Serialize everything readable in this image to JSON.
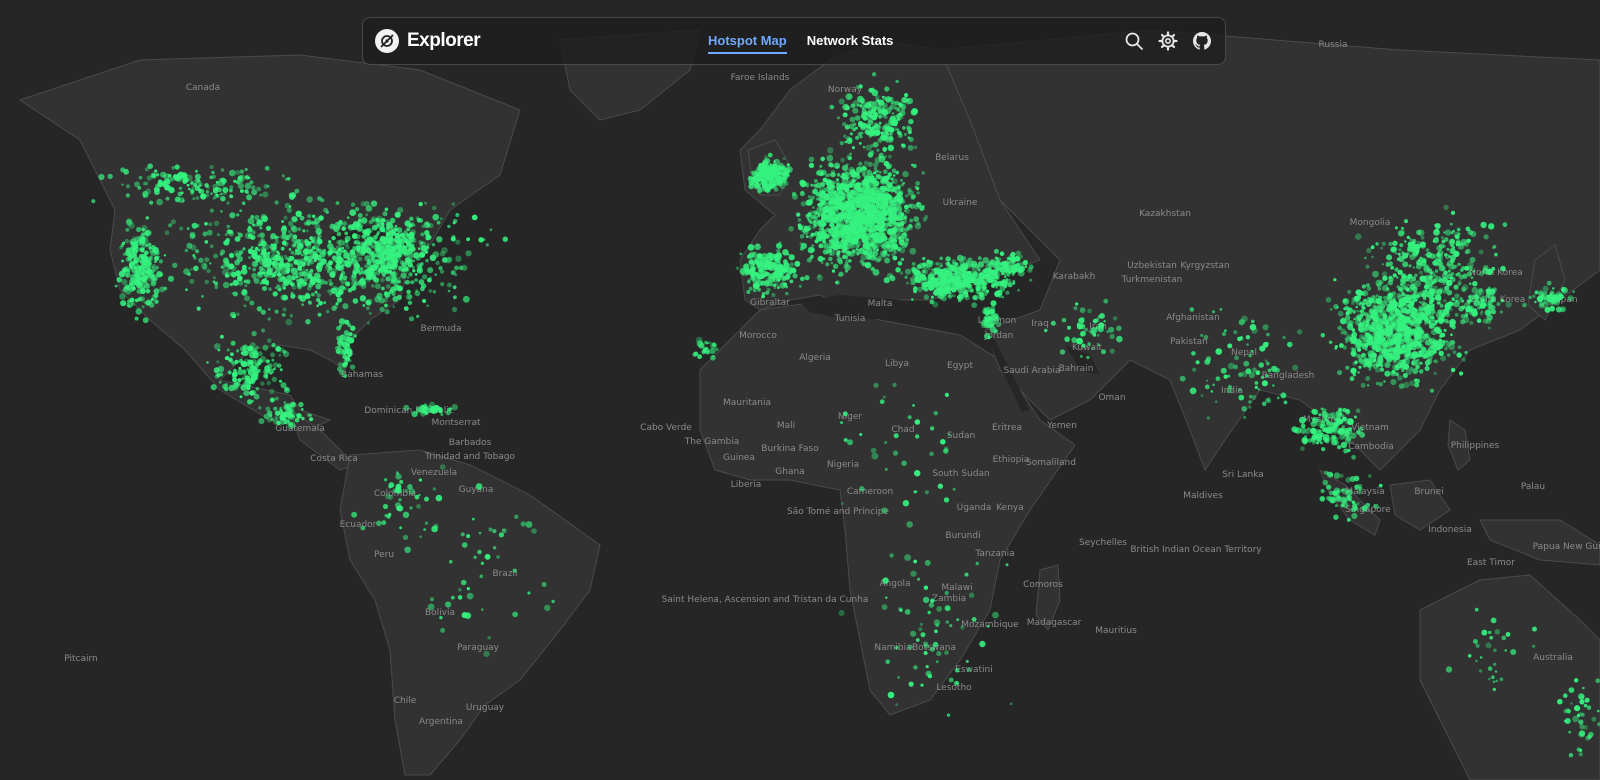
{
  "app": {
    "title": "Explorer",
    "accent": "#6ea8ff",
    "hotspot_color": "#35f27f",
    "background": "#262626",
    "land_color": "#323232"
  },
  "nav": {
    "tabs": [
      {
        "label": "Hotspot Map",
        "active": true
      },
      {
        "label": "Network Stats",
        "active": false
      }
    ]
  },
  "actions": {
    "icons": [
      "search-icon",
      "gear-icon",
      "github-icon"
    ]
  },
  "map": {
    "labels": [
      "Russia",
      "Canada",
      "Faroe Islands",
      "Kazakhstan",
      "Mongolia",
      "Bermuda",
      "Tunisia",
      "Morocco",
      "Algeria",
      "Libya",
      "Egypt",
      "Iraq",
      "Iran",
      "Afghanistan",
      "Pakistan",
      "India",
      "Saudi Arabia",
      "Oman",
      "Yemen",
      "Mauritania",
      "Mali",
      "Niger",
      "Chad",
      "Sudan",
      "Eritrea",
      "Ethiopia",
      "Somaliland",
      "South Sudan",
      "Cabo Verde",
      "The Gambia",
      "Burkina Faso",
      "Guinea",
      "Ghana",
      "Nigeria",
      "Liberia",
      "Cameroon",
      "São Tomé and Príncipe",
      "Uganda",
      "Kenya",
      "Burundi",
      "Tanzania",
      "Angola",
      "Zambia",
      "Malawi",
      "Comoros",
      "Mozambique",
      "Madagascar",
      "Mauritius",
      "Namibia",
      "Botswana",
      "Eswatini",
      "Lesotho",
      "Seychelles",
      "British Indian Ocean Territory",
      "Maldives",
      "Sri Lanka",
      "Myanmar",
      "Vietnam",
      "Cambodia",
      "Philippines",
      "Palau",
      "Brunei",
      "Malaysia",
      "Singapore",
      "Indonesia",
      "East Timor",
      "Papua New Guinea",
      "Australia",
      "North Korea",
      "South Korea",
      "Japan",
      "Turkmenistan",
      "Uzbekistan",
      "Kyrgyzstan",
      "Karabakh",
      "Kuwait",
      "Bahrain",
      "Bangladesh",
      "Nepal",
      "Norway",
      "Belarus",
      "Ukraine",
      "Malta",
      "Gibraltar",
      "Lebanon",
      "Jordan",
      "Saint Helena, Ascension and Tristan da Cunha",
      "Pitcairn",
      "Brazil",
      "Peru",
      "Bolivia",
      "Paraguay",
      "Uruguay",
      "Argentina",
      "Chile",
      "Ecuador",
      "Colombia",
      "Venezuela",
      "Guyana",
      "Trinidad and Tobago",
      "Barbados",
      "Montserrat",
      "Dominican Republic",
      "Bahamas",
      "Guatemala",
      "Costa Rica"
    ]
  }
}
